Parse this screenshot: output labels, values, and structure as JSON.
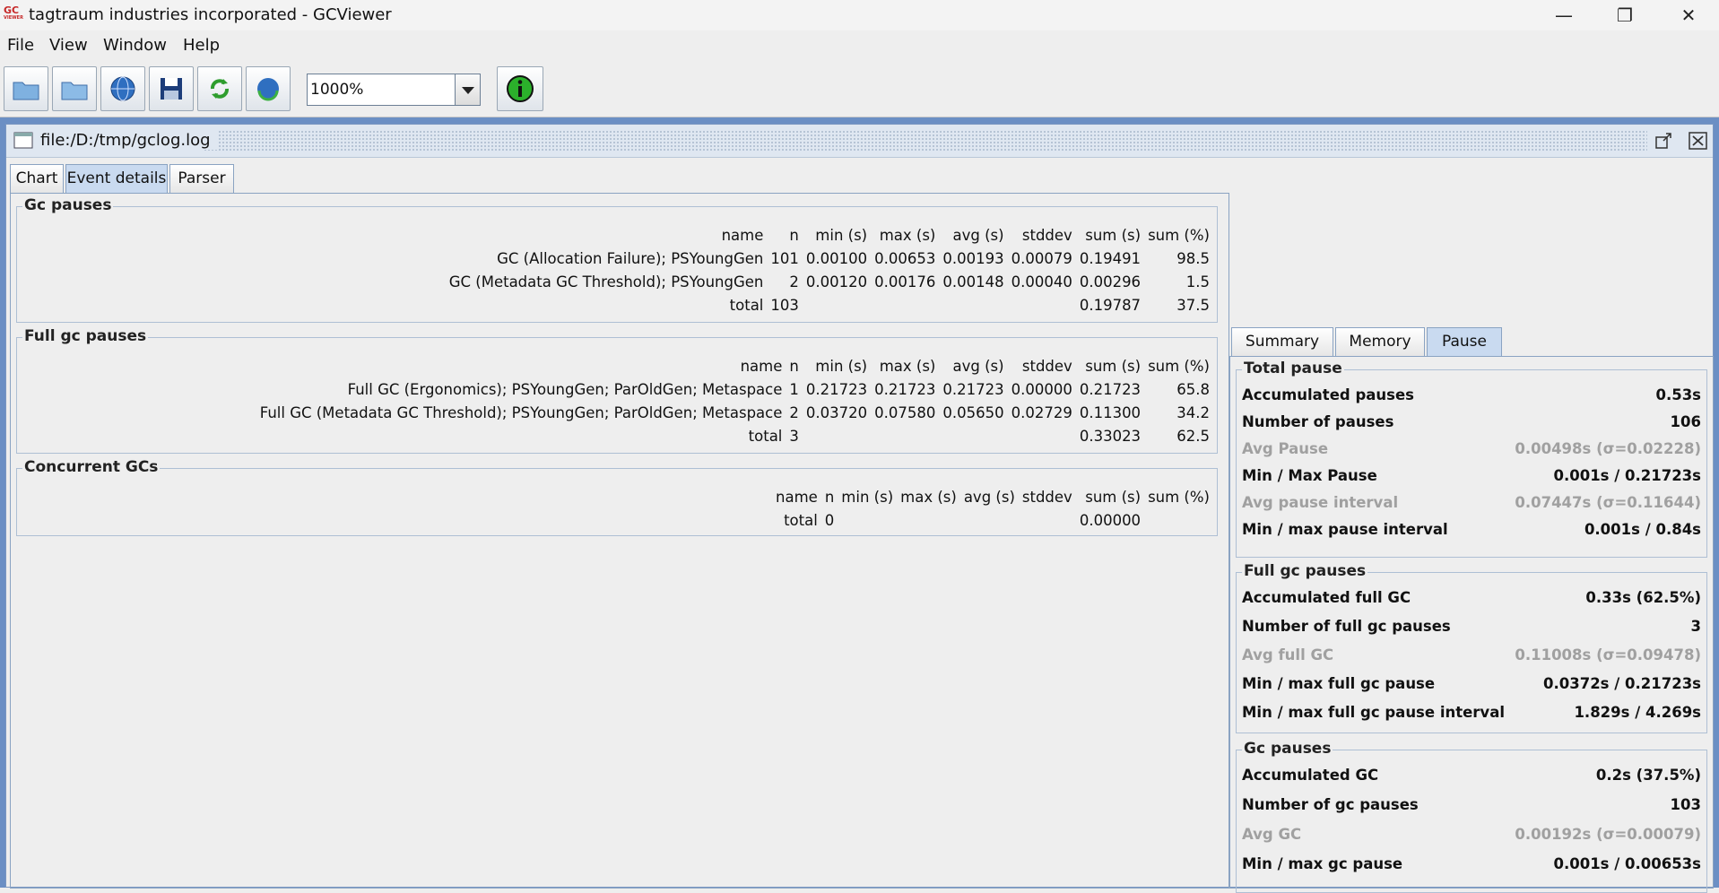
{
  "window": {
    "title": "tagtraum industries incorporated - GCViewer",
    "logo": "GC",
    "logo_sub": "VIEWER"
  },
  "menu": [
    "File",
    "View",
    "Window",
    "Help"
  ],
  "toolbar": {
    "zoom_value": "1000%"
  },
  "doc": {
    "title": "file:/D:/tmp/gclog.log"
  },
  "tabs": [
    "Chart",
    "Event details",
    "Parser"
  ],
  "right_tabs": [
    "Summary",
    "Memory",
    "Pause"
  ],
  "gc_pauses": {
    "title": "Gc pauses",
    "headers": [
      "name",
      "n",
      "min (s)",
      "max (s)",
      "avg (s)",
      "stddev",
      "sum (s)",
      "sum (%)"
    ],
    "rows": [
      [
        "GC (Allocation Failure); PSYoungGen",
        "101",
        "0.00100",
        "0.00653",
        "0.00193",
        "0.00079",
        "0.19491",
        "98.5"
      ],
      [
        "GC (Metadata GC Threshold); PSYoungGen",
        "2",
        "0.00120",
        "0.00176",
        "0.00148",
        "0.00040",
        "0.00296",
        "1.5"
      ],
      [
        "total",
        "103",
        "",
        "",
        "",
        "",
        "0.19787",
        "37.5"
      ]
    ]
  },
  "full_gc_pauses": {
    "title": "Full gc pauses",
    "headers": [
      "name",
      "n",
      "min (s)",
      "max (s)",
      "avg (s)",
      "stddev",
      "sum (s)",
      "sum (%)"
    ],
    "rows": [
      [
        "Full GC (Ergonomics); PSYoungGen; ParOldGen; Metaspace",
        "1",
        "0.21723",
        "0.21723",
        "0.21723",
        "0.00000",
        "0.21723",
        "65.8"
      ],
      [
        "Full GC (Metadata GC Threshold); PSYoungGen; ParOldGen; Metaspace",
        "2",
        "0.03720",
        "0.07580",
        "0.05650",
        "0.02729",
        "0.11300",
        "34.2"
      ],
      [
        "total",
        "3",
        "",
        "",
        "",
        "",
        "0.33023",
        "62.5"
      ]
    ]
  },
  "concurrent_gcs": {
    "title": "Concurrent GCs",
    "headers": [
      "name",
      "n",
      "min (s)",
      "max (s)",
      "avg (s)",
      "stddev",
      "sum (s)",
      "sum (%)"
    ],
    "rows": [
      [
        "total",
        "0",
        "",
        "",
        "",
        "",
        "0.00000",
        ""
      ]
    ]
  },
  "pause_panel": {
    "total_pause": {
      "title": "Total pause",
      "rows": [
        {
          "label": "Accumulated pauses",
          "value": "0.53s",
          "dim": false
        },
        {
          "label": "Number of pauses",
          "value": "106",
          "dim": false
        },
        {
          "label": "Avg Pause",
          "value": "0.00498s (σ=0.02228)",
          "dim": true
        },
        {
          "label": "Min / Max Pause",
          "value": "0.001s / 0.21723s",
          "dim": false
        },
        {
          "label": "Avg pause interval",
          "value": "0.07447s (σ=0.11644)",
          "dim": true
        },
        {
          "label": "Min / max pause interval",
          "value": "0.001s / 0.84s",
          "dim": false
        }
      ]
    },
    "full_gc_pauses": {
      "title": "Full gc pauses",
      "rows": [
        {
          "label": "Accumulated full GC",
          "value": "0.33s (62.5%)",
          "dim": false
        },
        {
          "label": "Number of full gc pauses",
          "value": "3",
          "dim": false
        },
        {
          "label": "Avg full GC",
          "value": "0.11008s (σ=0.09478)",
          "dim": true
        },
        {
          "label": "Min / max full gc pause",
          "value": "0.0372s / 0.21723s",
          "dim": false
        },
        {
          "label": "Min / max full gc pause interval",
          "value": "1.829s / 4.269s",
          "dim": false
        }
      ]
    },
    "gc_pauses": {
      "title": "Gc pauses",
      "rows": [
        {
          "label": "Accumulated GC",
          "value": "0.2s (37.5%)",
          "dim": false
        },
        {
          "label": "Number of gc pauses",
          "value": "103",
          "dim": false
        },
        {
          "label": "Avg GC",
          "value": "0.00192s (σ=0.00079)",
          "dim": true
        },
        {
          "label": "Min / max gc pause",
          "value": "0.001s / 0.00653s",
          "dim": false
        }
      ]
    }
  },
  "colors": {
    "accent": "#c9daf0",
    "desktop": "#6b8fc4",
    "dim_text": "#a0a0a0"
  }
}
